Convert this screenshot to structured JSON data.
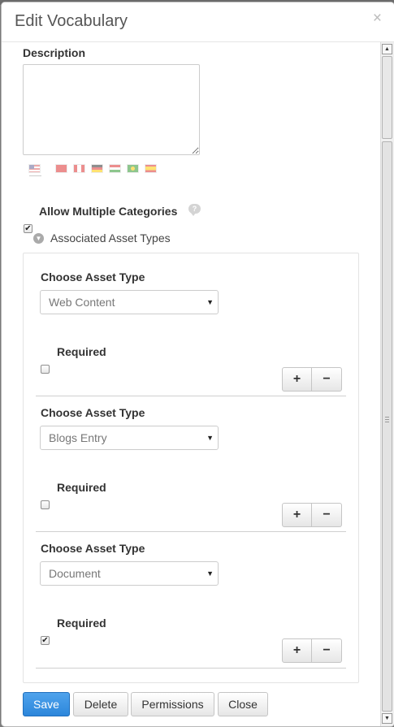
{
  "dialog": {
    "title": "Edit Vocabulary",
    "close_glyph": "×"
  },
  "description": {
    "label": "Description",
    "value": ""
  },
  "language_flags": [
    "flag-us-icon",
    "flag-cn-icon",
    "flag-ca-icon",
    "flag-de-icon",
    "flag-hu-icon",
    "flag-br-icon",
    "flag-es-icon"
  ],
  "allow_multiple": {
    "label": "Allow Multiple Categories",
    "checked": true,
    "help_icon": "question-bubble-icon"
  },
  "associated": {
    "label": "Associated Asset Types",
    "toggle_icon": "chevron-down-icon"
  },
  "asset_rows": [
    {
      "choose_label": "Choose Asset Type",
      "selected": "Web Content",
      "required_label": "Required",
      "required": false
    },
    {
      "choose_label": "Choose Asset Type",
      "selected": "Blogs Entry",
      "required_label": "Required",
      "required": false
    },
    {
      "choose_label": "Choose Asset Type",
      "selected": "Document",
      "required_label": "Required",
      "required": true
    }
  ],
  "row_buttons": {
    "plus": "+",
    "minus": "−"
  },
  "footer": {
    "save": "Save",
    "delete": "Delete",
    "permissions": "Permissions",
    "close": "Close"
  },
  "colors": {
    "primary": "#2c86db",
    "text": "#333333",
    "muted": "#777777"
  }
}
